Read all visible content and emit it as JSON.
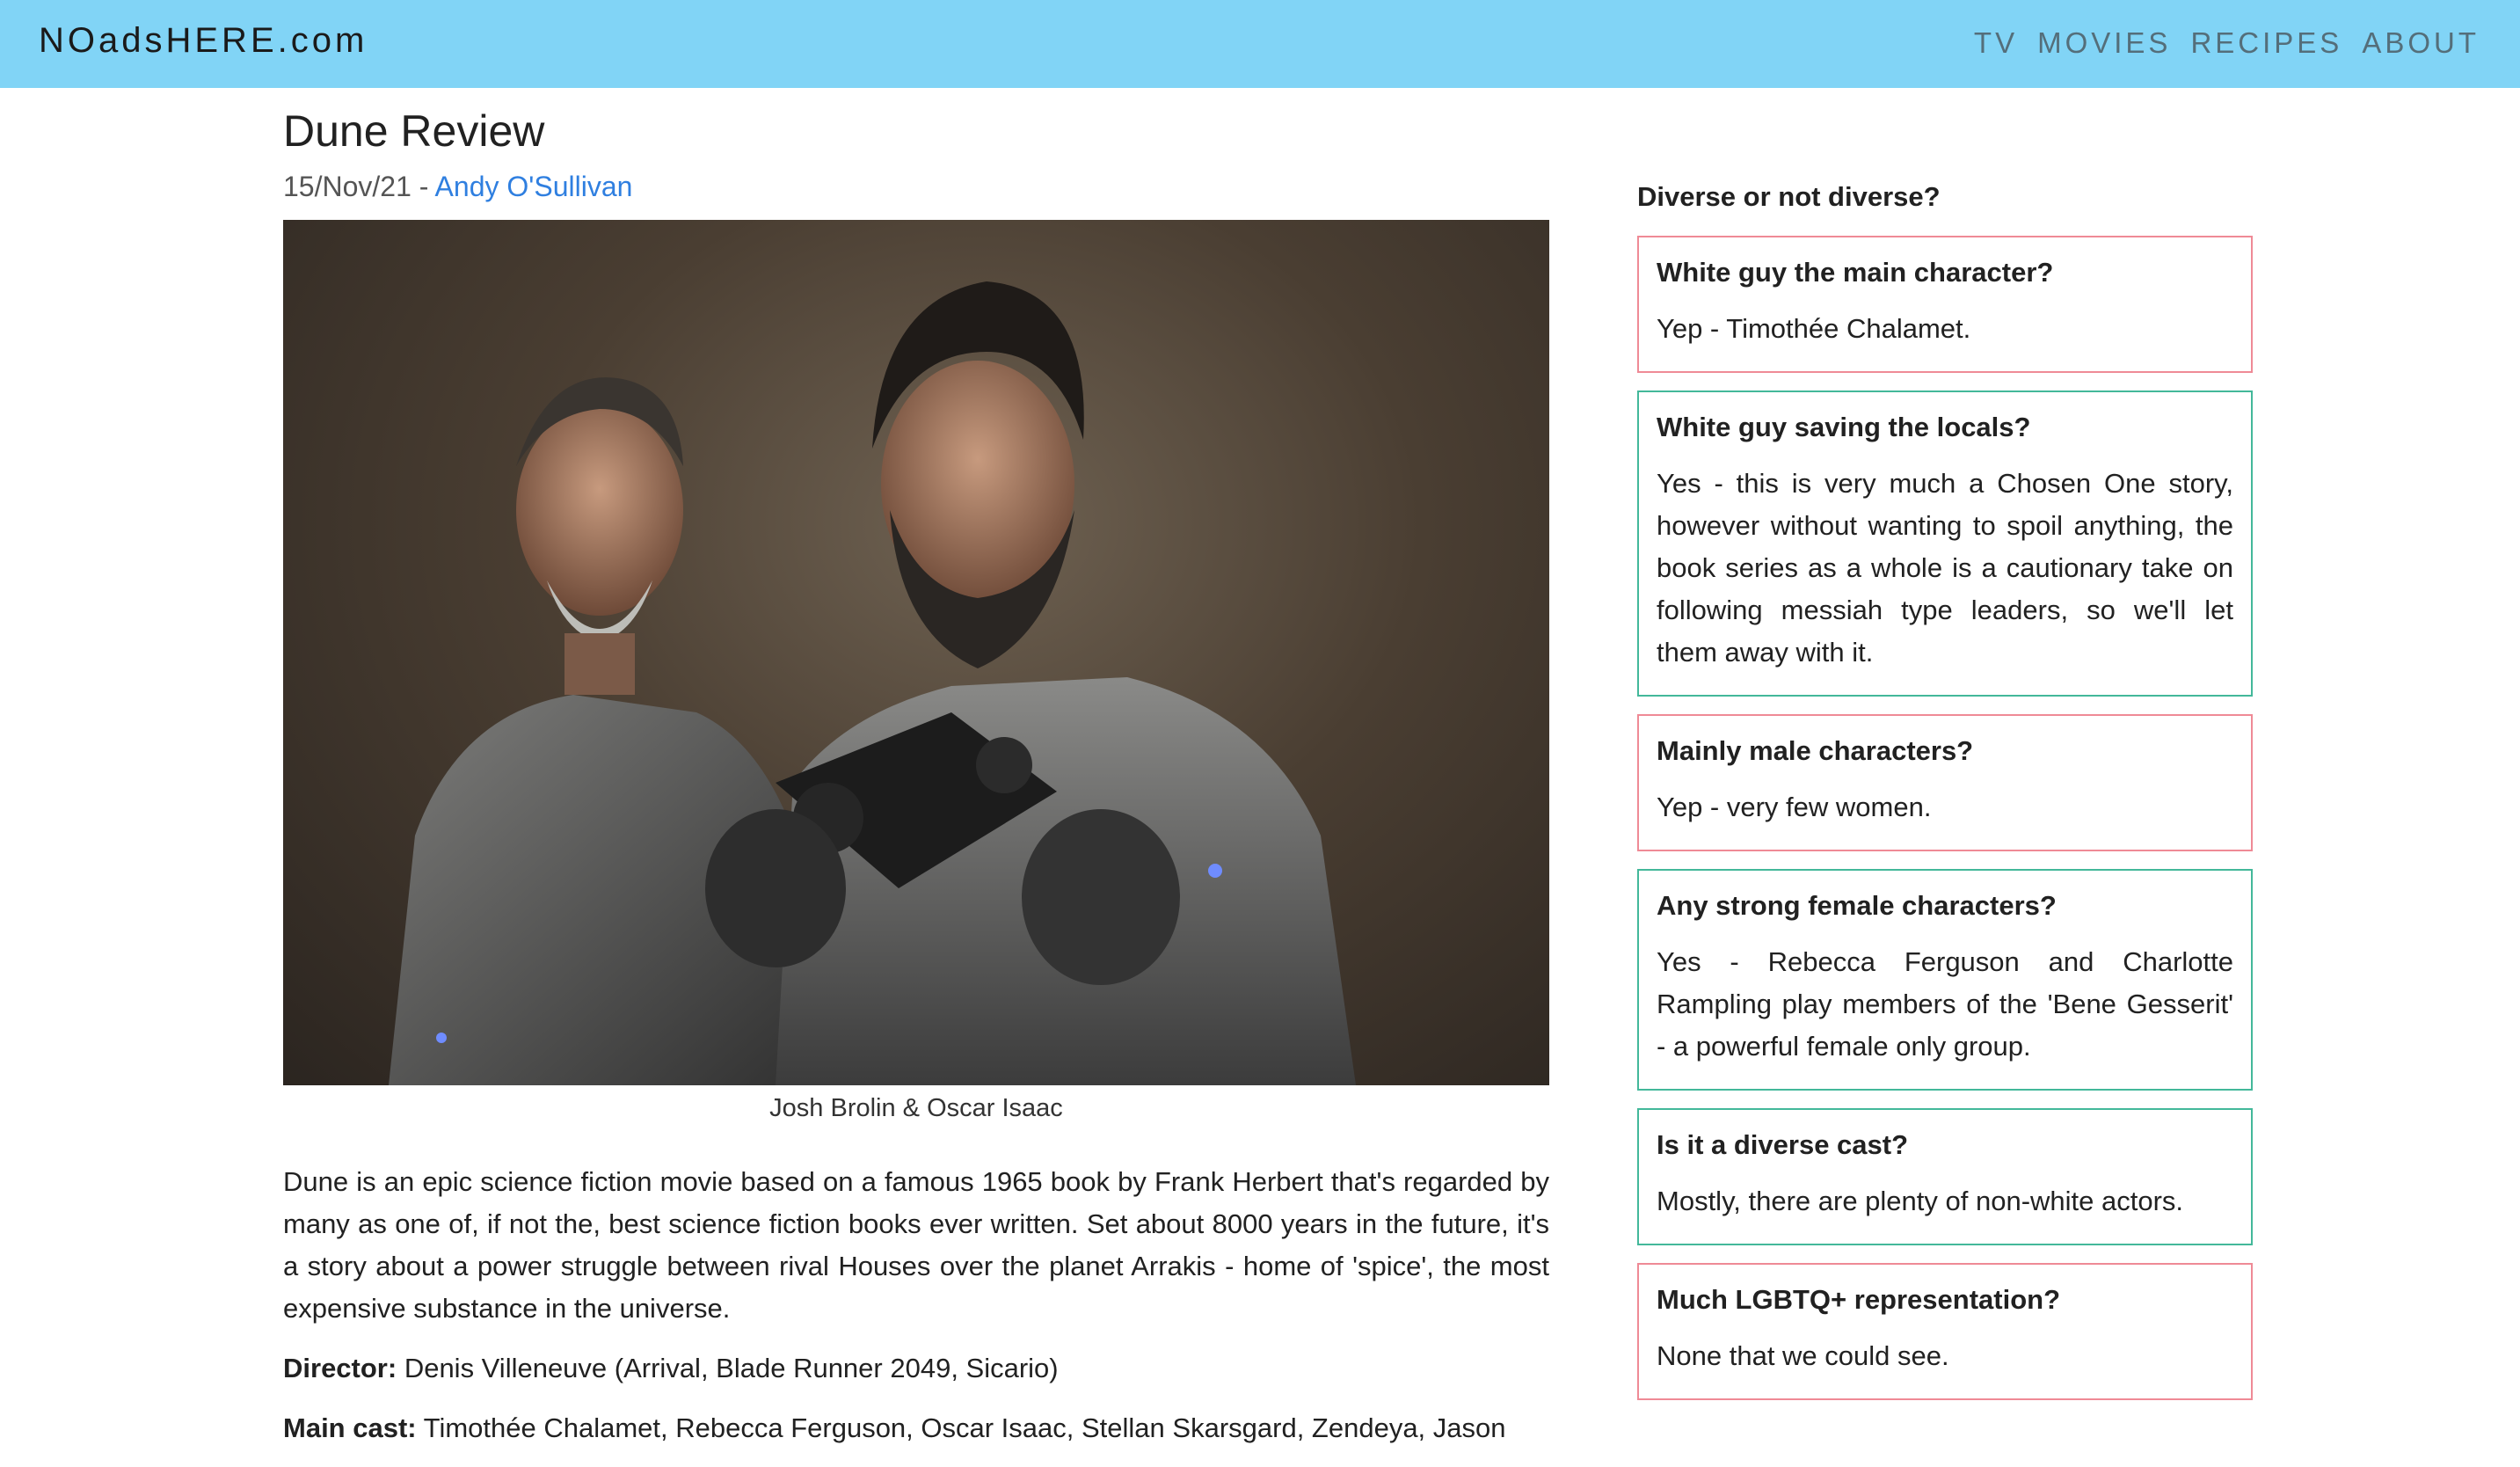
{
  "header": {
    "logo": "NOadsHERE.com",
    "nav": [
      "TV",
      "MOVIES",
      "RECIPES",
      "ABOUT"
    ]
  },
  "article": {
    "title": "Dune Review",
    "date": "15/Nov/21 - ",
    "author": "Andy O'Sullivan",
    "image_caption": "Josh Brolin & Oscar Isaac",
    "body": "Dune is an epic science fiction movie based on a famous 1965 book by Frank Herbert that's regarded by many as one of, if not the, best science fiction books ever written. Set about 8000 years in the future, it's a story about a power struggle between rival Houses over the planet Arrakis - home of 'spice', the most expensive substance in the universe.",
    "director_label": "Director:",
    "director": " Denis Villeneuve (Arrival, Blade Runner 2049, Sicario)",
    "cast_label": "Main cast:",
    "cast": " Timothée Chalamet, Rebecca Ferguson, Oscar Isaac, Stellan Skarsgard, Zendeya, Jason"
  },
  "sidebar": {
    "heading": "Diverse or not diverse?",
    "cards": [
      {
        "question": "White guy the main character?",
        "answer": "Yep - Timothée Chalamet.",
        "status": "red"
      },
      {
        "question": "White guy saving the locals?",
        "answer": "Yes - this is very much a Chosen One story, however without wanting to spoil anything, the book series as a whole is a cautionary take on following messiah type leaders, so we'll let them away with it.",
        "status": "green"
      },
      {
        "question": "Mainly male characters?",
        "answer": "Yep - very few women.",
        "status": "red"
      },
      {
        "question": "Any strong female characters?",
        "answer": "Yes - Rebecca Ferguson and Charlotte Rampling play members of the 'Bene Gesserit' - a powerful female only group.",
        "status": "green"
      },
      {
        "question": "Is it a diverse cast?",
        "answer": "Mostly, there are plenty of non-white actors.",
        "status": "green"
      },
      {
        "question": "Much LGBTQ+ representation?",
        "answer": "None that we could see.",
        "status": "red"
      }
    ]
  },
  "colors": {
    "header_bg": "#81d4f6",
    "link": "#2f7fe0",
    "card_red_border": "#ef8a96",
    "card_green_border": "#43b89a"
  }
}
